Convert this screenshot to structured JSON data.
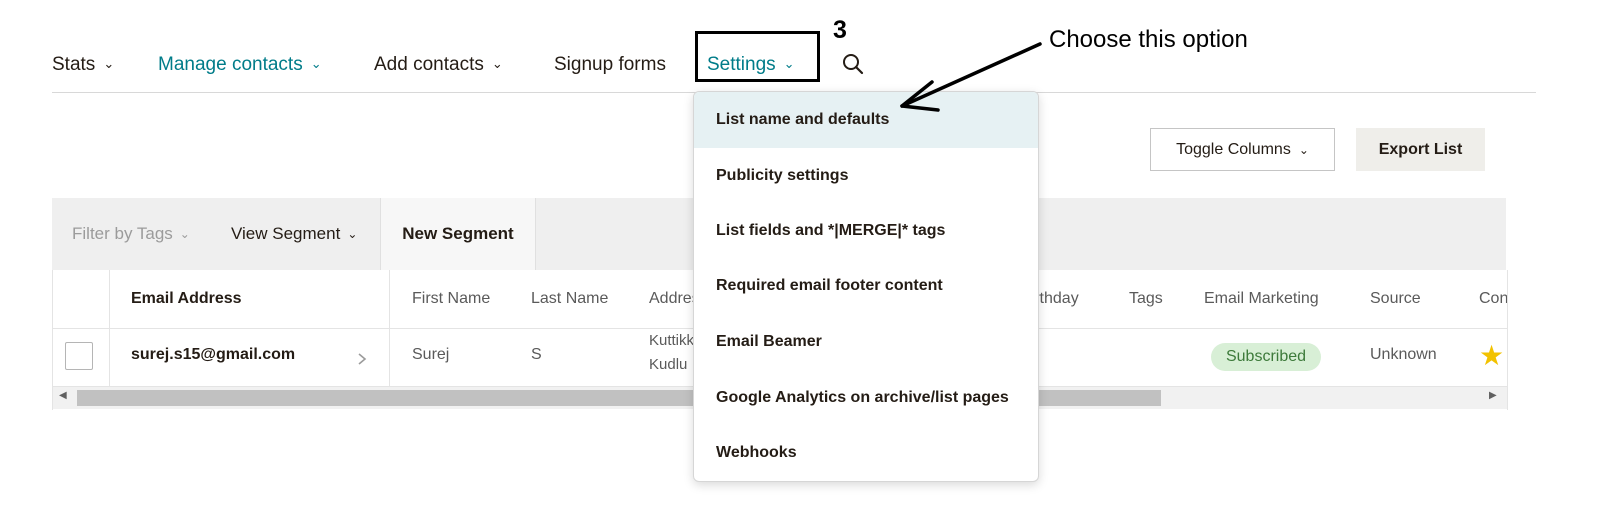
{
  "nav": {
    "stats": "Stats",
    "manage_contacts": "Manage contacts",
    "add_contacts": "Add contacts",
    "signup_forms": "Signup forms",
    "settings": "Settings",
    "chevron": "⌄"
  },
  "annotation": {
    "step_number": "3",
    "callout_text": "Choose this option"
  },
  "actions": {
    "toggle_columns": "Toggle Columns",
    "export_list": "Export List"
  },
  "toolbar": {
    "filter_by_tags": "Filter by Tags",
    "view_segment": "View Segment",
    "new_segment": "New Segment"
  },
  "table": {
    "headers": {
      "email": "Email Address",
      "first_name": "First Name",
      "last_name": "Last Name",
      "address": "Address",
      "birthday": "Birthday",
      "tags": "Tags",
      "email_marketing": "Email Marketing",
      "source": "Source",
      "contact_rating": "Con"
    },
    "rows": [
      {
        "email": "surej.s15@gmail.com",
        "first_name": "Surej",
        "last_name": "S",
        "address_line1": "Kuttikk",
        "address_line2": "Kudlu",
        "email_marketing": "Subscribed",
        "source": "Unknown",
        "rating_star": "★"
      }
    ]
  },
  "settings_menu": [
    "List name and defaults",
    "Publicity settings",
    "List fields and *|MERGE|* tags",
    "Required email footer content",
    "Email Beamer",
    "Google Analytics on archive/list pages",
    "Webhooks"
  ],
  "colors": {
    "teal": "#007c89",
    "highlight": "#e6f1f3",
    "badge_bg": "#d8efd6",
    "star": "#f2c200"
  }
}
